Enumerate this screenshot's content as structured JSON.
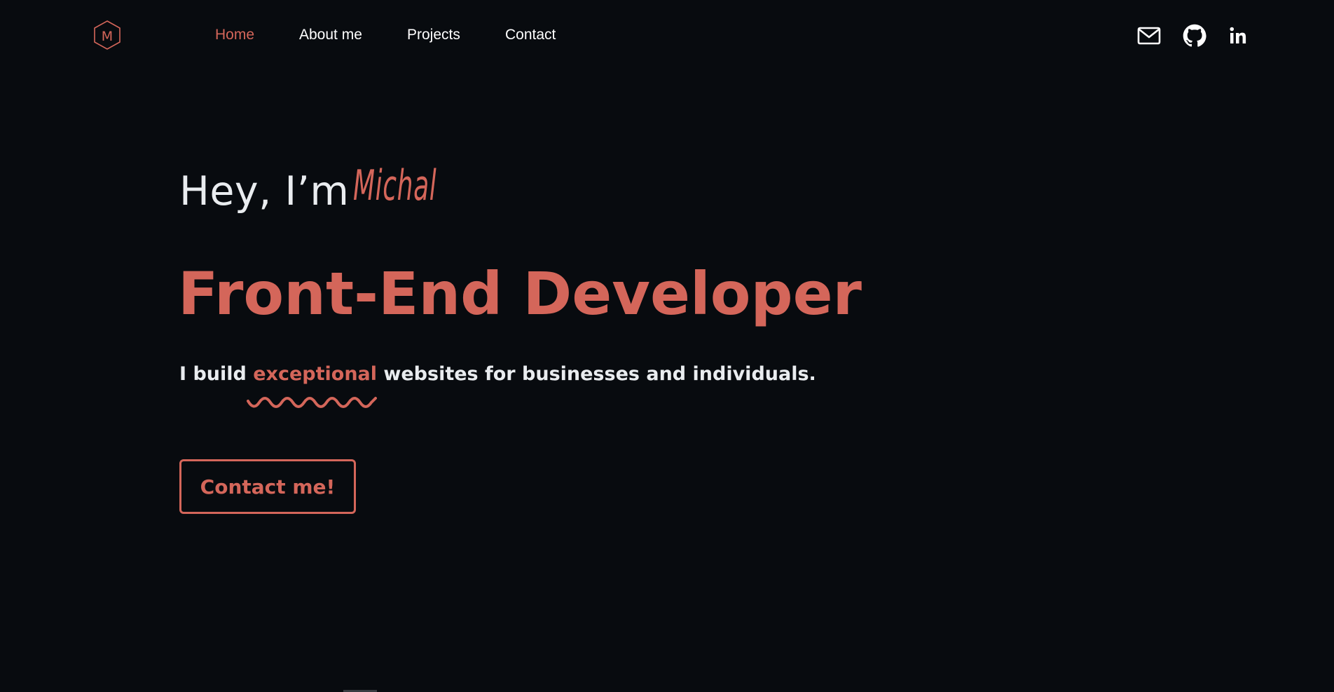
{
  "header": {
    "logo_letter": "M",
    "nav": [
      {
        "label": "Home",
        "active": true
      },
      {
        "label": "About me",
        "active": false
      },
      {
        "label": "Projects",
        "active": false
      },
      {
        "label": "Contact",
        "active": false
      }
    ],
    "social": [
      "mail-icon",
      "github-icon",
      "linkedin-icon"
    ]
  },
  "hero": {
    "greeting": "Hey, I’m",
    "name": "Michal",
    "role": "Front-End Developer",
    "tagline_start": "I build ",
    "tagline_accent": "exceptional",
    "tagline_end": " websites for businesses and individuals.",
    "cta_label": "Contact me!"
  },
  "colors": {
    "background": "#080b0f",
    "accent": "#d4665a",
    "text": "#e9ecef"
  }
}
